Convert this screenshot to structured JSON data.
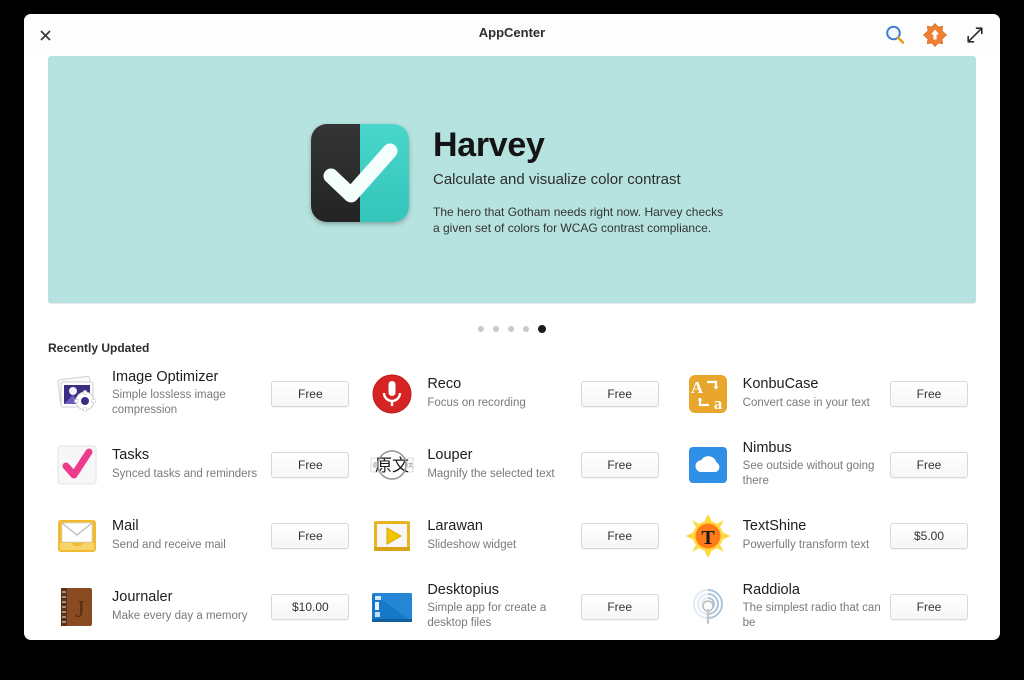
{
  "window": {
    "title": "AppCenter",
    "close_label": "×",
    "actions": [
      {
        "name": "search-icon",
        "label": "Search"
      },
      {
        "name": "updates-icon",
        "label": "Updates"
      },
      {
        "name": "maximize-icon",
        "label": "Maximize"
      }
    ]
  },
  "banner": {
    "app_name": "Harvey",
    "tagline": "Calculate and visualize color contrast",
    "description": "The hero that Gotham needs right now. Harvey checks a given set of colors for WCAG contrast compliance.",
    "background_color": "#b6e3df",
    "icon_dark_color": "#2b2b2b",
    "icon_teal_color": "#3dcfc4",
    "dots": {
      "count": 5,
      "active_index": 4
    }
  },
  "section": {
    "title": "Recently Updated"
  },
  "apps": [
    {
      "name": "Image Optimizer",
      "description": "Simple lossless image compression",
      "price": "Free",
      "icon": "photo-gear-icon",
      "color": "#3b2d82"
    },
    {
      "name": "Reco",
      "description": "Focus on recording",
      "price": "Free",
      "icon": "microphone-icon",
      "color": "#d32020"
    },
    {
      "name": "KonbuCase",
      "description": "Convert case in your text",
      "price": "Free",
      "icon": "case-convert-icon",
      "color": "#e8a72c"
    },
    {
      "name": "Tasks",
      "description": "Synced tasks and reminders",
      "price": "Free",
      "icon": "pink-check-icon",
      "color": "#f0388c"
    },
    {
      "name": "Louper",
      "description": "Magnify the selected text",
      "price": "Free",
      "icon": "magnify-text-icon",
      "color": "#8d8d8d"
    },
    {
      "name": "Nimbus",
      "description": "See outside without going there",
      "price": "Free",
      "icon": "cloud-icon",
      "color": "#2f92e8"
    },
    {
      "name": "Mail",
      "description": "Send and receive mail",
      "price": "Free",
      "icon": "envelope-icon",
      "color": "#f3c03a"
    },
    {
      "name": "Larawan",
      "description": "Slideshow widget",
      "price": "Free",
      "icon": "play-slideshow-icon",
      "color": "#f0c020"
    },
    {
      "name": "TextShine",
      "description": "Powerfully transform text",
      "price": "$5.00",
      "icon": "sun-t-icon",
      "color": "#ff7a18"
    },
    {
      "name": "Journaler",
      "description": "Make every day a memory",
      "price": "$10.00",
      "icon": "notebook-j-icon",
      "color": "#8a4a22"
    },
    {
      "name": "Desktopius",
      "description": "Simple app for create a desktop files",
      "price": "Free",
      "icon": "desktop-screen-icon",
      "color": "#1878c8"
    },
    {
      "name": "Raddiola",
      "description": "The simplest radio that can be",
      "price": "Free",
      "icon": "radio-antenna-icon",
      "color": "#9bb9d6"
    }
  ]
}
